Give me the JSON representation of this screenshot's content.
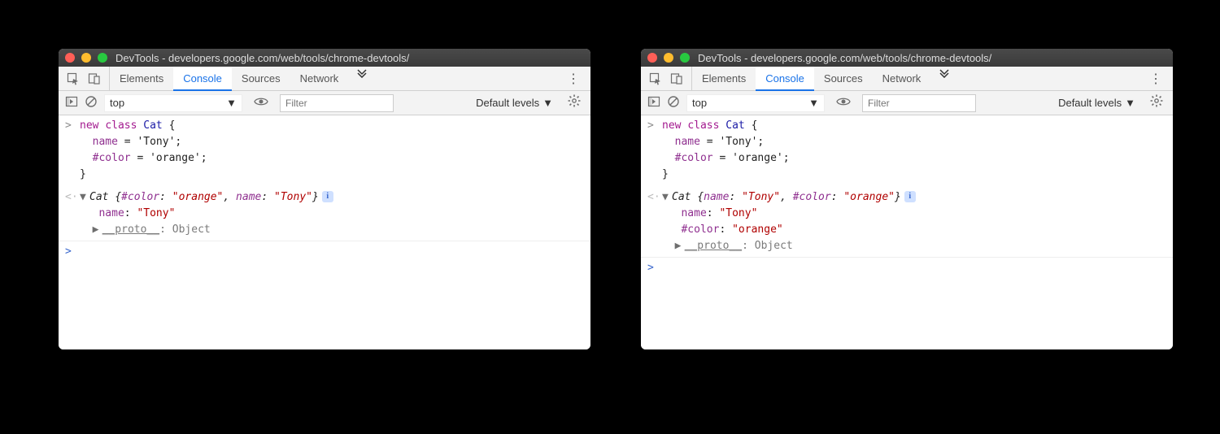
{
  "windows": {
    "left": {
      "title": "DevTools - developers.google.com/web/tools/chrome-devtools/",
      "tabs": {
        "elements": "Elements",
        "console": "Console",
        "sources": "Sources",
        "network": "Network"
      },
      "toolbar": {
        "context": "top",
        "filter_placeholder": "Filter",
        "levels": "Default levels"
      },
      "code": {
        "kw_new": "new",
        "kw_class": "class",
        "classname": "Cat",
        "brace_open": "{",
        "line2_prop": "name",
        "line2_rest": " = 'Tony';",
        "line3_prop": "#color",
        "line3_rest": " = 'orange';",
        "brace_close": "}"
      },
      "output": {
        "summary_class": "Cat ",
        "summary_open": "{",
        "summary_k1": "#color",
        "summary_colon1": ": ",
        "summary_v1": "\"orange\"",
        "summary_comma": ", ",
        "summary_k2": "name",
        "summary_colon2": ": ",
        "summary_v2": "\"Tony\"",
        "summary_close": "}",
        "prop1_k": "name",
        "prop1_colon": ": ",
        "prop1_v": "\"Tony\"",
        "proto_label": "__proto__",
        "proto_rest": ": Object"
      }
    },
    "right": {
      "title": "DevTools - developers.google.com/web/tools/chrome-devtools/",
      "tabs": {
        "elements": "Elements",
        "console": "Console",
        "sources": "Sources",
        "network": "Network"
      },
      "toolbar": {
        "context": "top",
        "filter_placeholder": "Filter",
        "levels": "Default levels"
      },
      "code": {
        "kw_new": "new",
        "kw_class": "class",
        "classname": "Cat",
        "brace_open": "{",
        "line2_prop": "name",
        "line2_rest": " = 'Tony';",
        "line3_prop": "#color",
        "line3_rest": " = 'orange';",
        "brace_close": "}"
      },
      "output": {
        "summary_class": "Cat ",
        "summary_open": "{",
        "summary_k1": "name",
        "summary_colon1": ": ",
        "summary_v1": "\"Tony\"",
        "summary_comma": ", ",
        "summary_k2": "#color",
        "summary_colon2": ": ",
        "summary_v2": "\"orange\"",
        "summary_close": "}",
        "prop1_k": "name",
        "prop1_colon": ": ",
        "prop1_v": "\"Tony\"",
        "prop2_k": "#color",
        "prop2_colon": ": ",
        "prop2_v": "\"orange\"",
        "proto_label": "__proto__",
        "proto_rest": ": Object"
      }
    }
  }
}
